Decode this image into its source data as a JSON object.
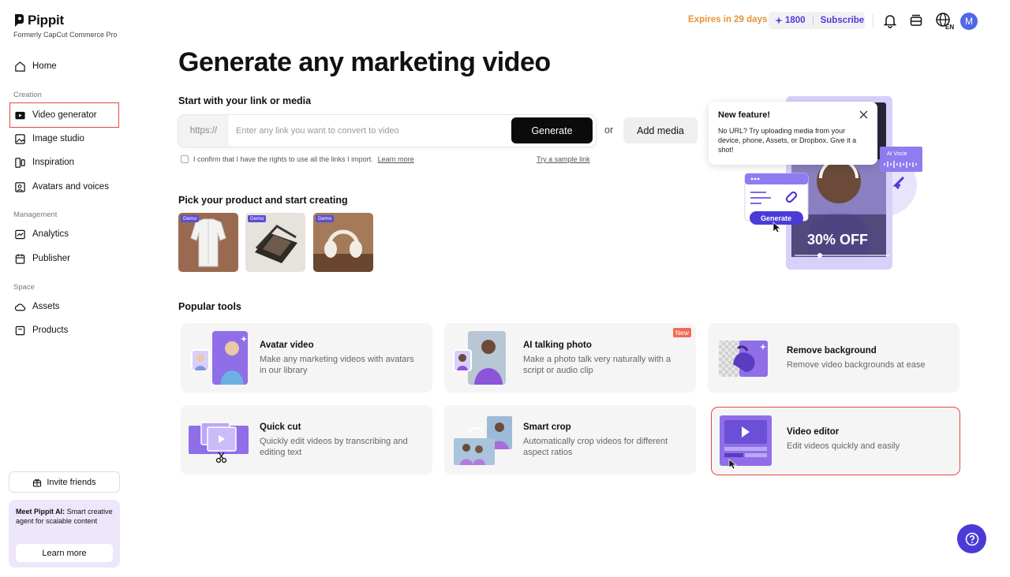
{
  "brand": {
    "name": "Pippit",
    "subtitle": "Formerly CapCut Commerce Pro"
  },
  "sidebar": {
    "home": "Home",
    "sections": [
      {
        "title": "Creation",
        "items": [
          "Video generator",
          "Image studio",
          "Inspiration",
          "Avatars and voices"
        ]
      },
      {
        "title": "Management",
        "items": [
          "Analytics",
          "Publisher"
        ]
      },
      {
        "title": "Space",
        "items": [
          "Assets",
          "Products"
        ]
      }
    ],
    "invite": "Invite friends",
    "promo": {
      "bold": "Meet Pippit AI:",
      "text": " Smart creative agent for scalable content",
      "button": "Learn more"
    }
  },
  "topbar": {
    "expires": "Expires in 29 days",
    "credits": "1800",
    "subscribe": "Subscribe",
    "avatar_letter": "M",
    "lang": "EN"
  },
  "main": {
    "title": "Generate any marketing video",
    "link_section": "Start with your link or media",
    "url_prefix": "https://",
    "url_placeholder": "Enter any link you want to convert to video",
    "generate": "Generate",
    "or": "or",
    "add_media": "Add media",
    "consent": "I confirm that I have the rights to use all the links I import.",
    "learn_more": "Learn more",
    "sample": "Try a sample link",
    "products_section": "Pick your product and start creating",
    "demo_tag": "Demo",
    "popular_section": "Popular tools"
  },
  "tooltip": {
    "title": "New feature!",
    "text": "No URL? Try uploading media from your device, phone, Assets, or Dropbox. Give it a shot!"
  },
  "promo_art": {
    "ai_voice": "AI Vocie",
    "generate": "Generate",
    "discount": "30% OFF"
  },
  "tools": [
    {
      "title": "Avatar video",
      "desc": "Make any marketing videos with avatars in our library"
    },
    {
      "title": "AI talking photo",
      "desc": "Make a photo talk very naturally with a script or audio clip",
      "badge": "New"
    },
    {
      "title": "Remove background",
      "desc": "Remove video backgrounds at ease"
    },
    {
      "title": "Quick cut",
      "desc": "Quickly edit videos by transcribing and editing text"
    },
    {
      "title": "Smart crop",
      "desc": "Automatically crop videos for different aspect ratios"
    },
    {
      "title": "Video editor",
      "desc": "Edit videos quickly and easily"
    }
  ],
  "colors": {
    "accent": "#4b3bd6",
    "highlight": "#e5483c",
    "expires": "#e79133"
  }
}
